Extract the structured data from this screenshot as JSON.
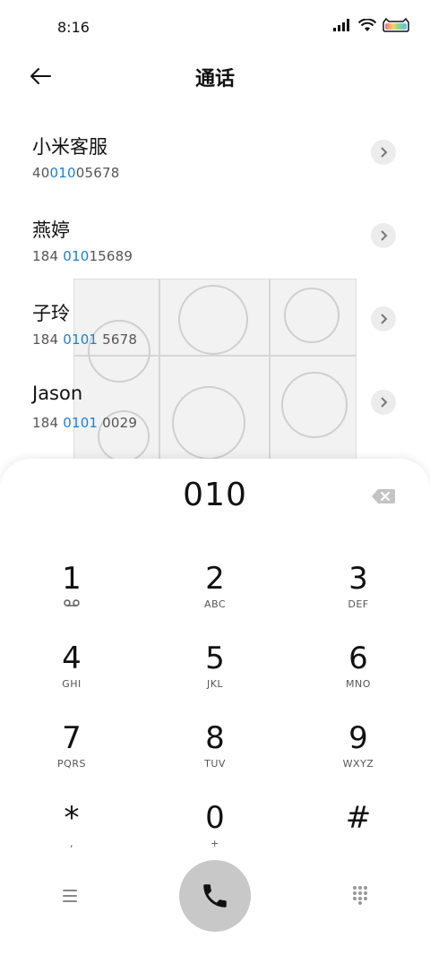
{
  "status": {
    "time": "8:16"
  },
  "header": {
    "title": "通话"
  },
  "contacts": [
    {
      "name": "小米客服",
      "num_pre": "40",
      "num_hl": "010",
      "num_post": "05678"
    },
    {
      "name": "燕婷",
      "num_pre": "184 ",
      "num_hl": "010",
      "num_post": "15689"
    },
    {
      "name": "子玲",
      "num_pre": "184 ",
      "num_hl": "0101",
      "num_post": " 5678"
    },
    {
      "name": "Jason",
      "num_pre": "184 ",
      "num_hl": "0101",
      "num_post": " 0029"
    }
  ],
  "dialer": {
    "input": "010",
    "keys": [
      {
        "digit": "1",
        "letters": ""
      },
      {
        "digit": "2",
        "letters": "ABC"
      },
      {
        "digit": "3",
        "letters": "DEF"
      },
      {
        "digit": "4",
        "letters": "GHI"
      },
      {
        "digit": "5",
        "letters": "JKL"
      },
      {
        "digit": "6",
        "letters": "MNO"
      },
      {
        "digit": "7",
        "letters": "PQRS"
      },
      {
        "digit": "8",
        "letters": "TUV"
      },
      {
        "digit": "9",
        "letters": "WXYZ"
      },
      {
        "digit": "*",
        "letters": ","
      },
      {
        "digit": "0",
        "letters": "+"
      },
      {
        "digit": "#",
        "letters": ""
      }
    ]
  },
  "colors": {
    "highlight": "#1a7fe0",
    "call_button": "#c8c8c8"
  }
}
